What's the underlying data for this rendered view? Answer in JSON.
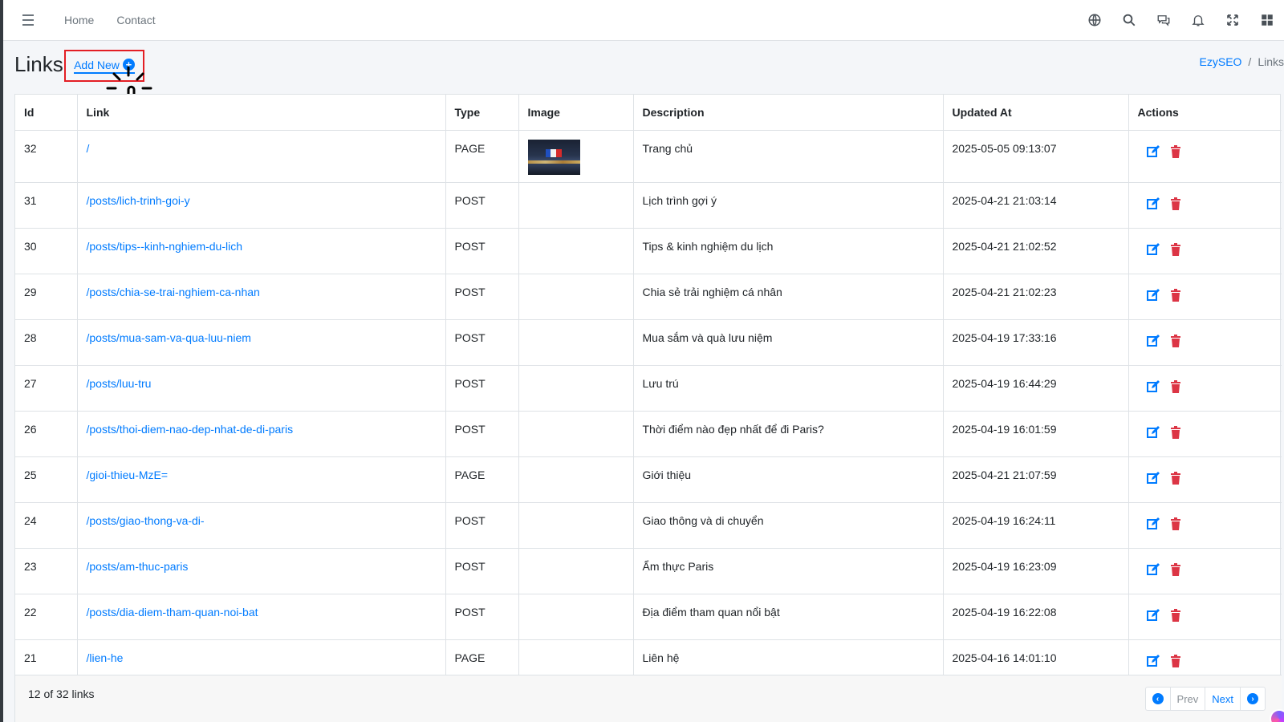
{
  "navbar": {
    "links": [
      "Home",
      "Contact"
    ],
    "icons": [
      "globe-icon",
      "search-icon",
      "chat-icon",
      "bell-icon",
      "fullscreen-icon",
      "apps-grid-icon"
    ]
  },
  "header": {
    "title": "Links",
    "add_new_label": "Add New",
    "breadcrumb": [
      "EzySEO",
      "Links"
    ]
  },
  "table": {
    "columns": [
      "Id",
      "Link",
      "Type",
      "Image",
      "Description",
      "Updated At",
      "Actions"
    ],
    "rows": [
      {
        "id": "32",
        "link": "/",
        "type": "PAGE",
        "image": true,
        "description": "Trang chủ",
        "updated_at": "2025-05-05 09:13:07"
      },
      {
        "id": "31",
        "link": "/posts/lich-trinh-goi-y",
        "type": "POST",
        "image": false,
        "description": "Lịch trình gợi ý",
        "updated_at": "2025-04-21 21:03:14"
      },
      {
        "id": "30",
        "link": "/posts/tips--kinh-nghiem-du-lich",
        "type": "POST",
        "image": false,
        "description": "Tips & kinh nghiệm du lịch",
        "updated_at": "2025-04-21 21:02:52"
      },
      {
        "id": "29",
        "link": "/posts/chia-se-trai-nghiem-ca-nhan",
        "type": "POST",
        "image": false,
        "description": "Chia sẻ trải nghiệm cá nhân",
        "updated_at": "2025-04-21 21:02:23"
      },
      {
        "id": "28",
        "link": "/posts/mua-sam-va-qua-luu-niem",
        "type": "POST",
        "image": false,
        "description": "Mua sắm và quà lưu niệm",
        "updated_at": "2025-04-19 17:33:16"
      },
      {
        "id": "27",
        "link": "/posts/luu-tru",
        "type": "POST",
        "image": false,
        "description": "Lưu trú",
        "updated_at": "2025-04-19 16:44:29"
      },
      {
        "id": "26",
        "link": "/posts/thoi-diem-nao-dep-nhat-de-di-paris",
        "type": "POST",
        "image": false,
        "description": "Thời điểm nào đẹp nhất để đi Paris?",
        "updated_at": "2025-04-19 16:01:59"
      },
      {
        "id": "25",
        "link": "/gioi-thieu-MzE=",
        "type": "PAGE",
        "image": false,
        "description": "Giới thiệu",
        "updated_at": "2025-04-21 21:07:59"
      },
      {
        "id": "24",
        "link": "/posts/giao-thong-va-di-",
        "type": "POST",
        "image": false,
        "description": "Giao thông và di chuyển",
        "updated_at": "2025-04-19 16:24:11"
      },
      {
        "id": "23",
        "link": "/posts/am-thuc-paris",
        "type": "POST",
        "image": false,
        "description": "Ẩm thực Paris",
        "updated_at": "2025-04-19 16:23:09"
      },
      {
        "id": "22",
        "link": "/posts/dia-diem-tham-quan-noi-bat",
        "type": "POST",
        "image": false,
        "description": "Địa điểm tham quan nổi bật",
        "updated_at": "2025-04-19 16:22:08"
      },
      {
        "id": "21",
        "link": "/lien-he",
        "type": "PAGE",
        "image": false,
        "description": "Liên hệ",
        "updated_at": "2025-04-16 14:01:10"
      }
    ]
  },
  "footer": {
    "count_text": "12 of 32 links",
    "prev_label": "Prev",
    "next_label": "Next"
  },
  "colors": {
    "link": "#007bff",
    "delete": "#dc3545",
    "highlight_box": "#e31e24"
  }
}
